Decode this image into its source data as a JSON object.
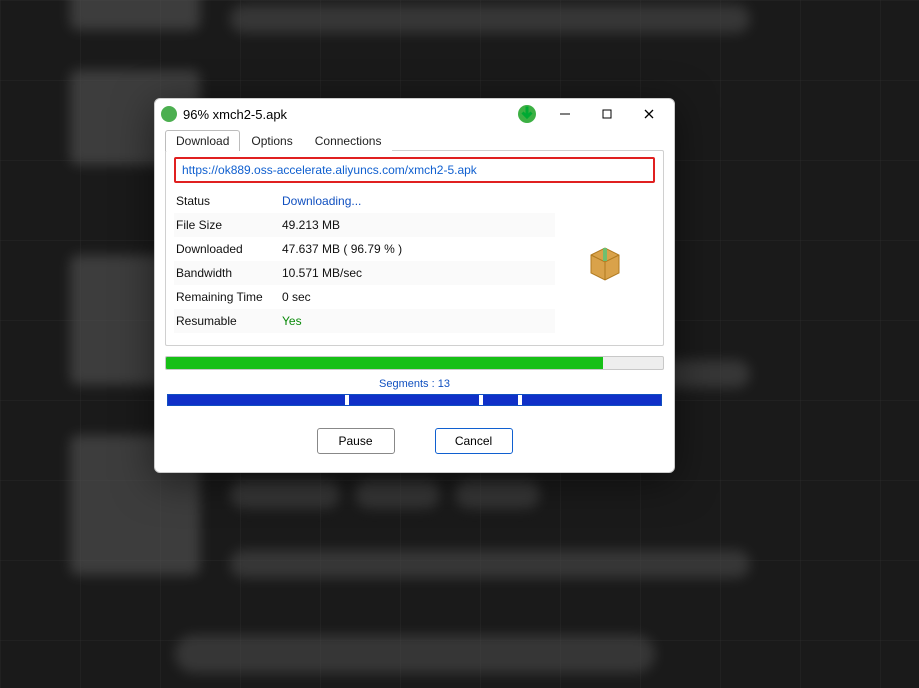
{
  "title": "96%  xmch2-5.apk",
  "tabs": {
    "download": "Download",
    "options": "Options",
    "connections": "Connections"
  },
  "url": "https://ok889.oss-accelerate.aliyuncs.com/xmch2-5.apk",
  "rows": {
    "status": {
      "label": "Status",
      "value": "Downloading..."
    },
    "file_size": {
      "label": "File Size",
      "value": "49.213 MB"
    },
    "downloaded": {
      "label": "Downloaded",
      "value": "47.637 MB ( 96.79 % )"
    },
    "bandwidth": {
      "label": "Bandwidth",
      "value": "10.571 MB/sec"
    },
    "remaining": {
      "label": "Remaining Time",
      "value": "0 sec"
    },
    "resumable": {
      "label": "Resumable",
      "value": "Yes"
    }
  },
  "progress_percent": 88,
  "segments_label": "Segments : 13",
  "segment_ticks_percent": [
    36,
    63,
    71
  ],
  "buttons": {
    "pause": "Pause",
    "cancel": "Cancel"
  }
}
